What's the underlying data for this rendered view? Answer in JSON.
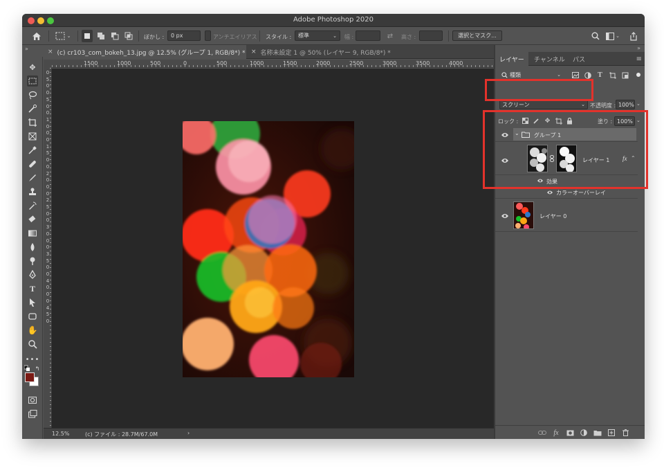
{
  "window": {
    "title": "Adobe Photoshop 2020"
  },
  "options_bar": {
    "feather_label": "ぼかし :",
    "feather_value": "0 px",
    "antialias_label": "アンチエイリアス",
    "style_label": "スタイル :",
    "style_value": "標準",
    "width_label": "幅 :",
    "height_label": "高さ :",
    "select_mask_label": "選択とマスク..."
  },
  "document_tabs": [
    {
      "label": "(c) cr103_com_bokeh_13.jpg @ 12.5% (グループ 1, RGB/8*) *",
      "active": true
    },
    {
      "label": "名称未設定 1 @ 50% (レイヤー 9, RGB/8*) *",
      "active": false
    }
  ],
  "ruler": {
    "top_labels": [
      "1500",
      "1000",
      "500",
      "0",
      "500",
      "1000",
      "1500",
      "2000",
      "2500",
      "3000",
      "3500",
      "4000"
    ],
    "left_labels": [
      "0",
      "5",
      "0",
      "0",
      "5",
      "0",
      "0",
      "1",
      "0",
      "0",
      "0",
      "1",
      "5",
      "0",
      "0",
      "2",
      "0",
      "0",
      "0",
      "2",
      "5",
      "0",
      "0",
      "3",
      "0",
      "0",
      "0",
      "3",
      "5",
      "0",
      "0",
      "4",
      "0",
      "0",
      "0",
      "4",
      "5",
      "0"
    ]
  },
  "status_bar": {
    "zoom": "12.5%",
    "file_info": "(c) ファイル : 28.7M/67.0M",
    "arrow": "›"
  },
  "panel": {
    "tabs": [
      "レイヤー",
      "チャンネル",
      "パス"
    ],
    "filter_label": "種類",
    "blend_mode": "スクリーン",
    "opacity_label": "不透明度 :",
    "opacity_value": "100%",
    "lock_label": "ロック :",
    "fill_label": "塗り :",
    "fill_value": "100%"
  },
  "layers": {
    "group_name": "グループ 1",
    "layer1_name": "レイヤー 1",
    "fx_label": "fx",
    "effects_label": "効果",
    "effect_name": "カラーオーバーレイ",
    "layer0_name": "レイヤー 0"
  },
  "colors": {
    "foreground": "#7a1a14",
    "background": "#ffffff",
    "highlight": "#e3322b"
  }
}
